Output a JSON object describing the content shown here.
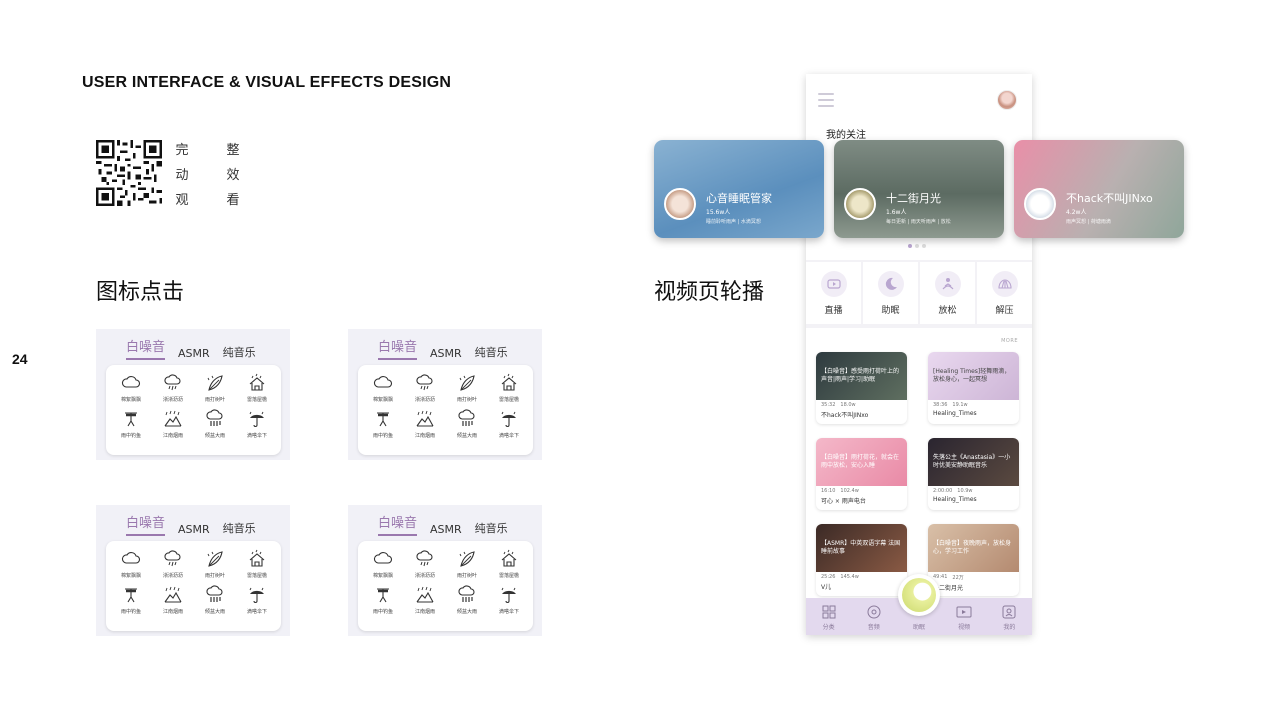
{
  "header": {
    "title": "USER INTERFACE & VISUAL EFFECTS DESIGN"
  },
  "page_number": "24",
  "qr_caption": {
    "col1": [
      "完",
      "动",
      "观"
    ],
    "col2": [
      "整",
      "效",
      "看"
    ]
  },
  "sections": {
    "icon_click": "图标点击",
    "carousel": "视频页轮播"
  },
  "tabs": [
    "白噪音",
    "ASMR",
    "纯音乐"
  ],
  "sound_icons": [
    {
      "label": "棉絮飘飘",
      "icon": "cloud-icon"
    },
    {
      "label": "淅淅沥沥",
      "icon": "cloud-rain-icon"
    },
    {
      "label": "雨打树叶",
      "icon": "leaf-rain-icon"
    },
    {
      "label": "雷落屋檐",
      "icon": "house-rain-icon"
    },
    {
      "label": "雨中钓鱼",
      "icon": "fishing-icon"
    },
    {
      "label": "江南烟雨",
      "icon": "mountain-rain-icon"
    },
    {
      "label": "倾盆大雨",
      "icon": "heavy-rain-icon"
    },
    {
      "label": "滴嗒伞下",
      "icon": "umbrella-icon"
    }
  ],
  "phone": {
    "follow_label": "我的关注",
    "carousel": [
      {
        "title": "心音睡眠管家",
        "count": "15.6w人",
        "desc": "睡前聆听雨声 | 水滴冥想"
      },
      {
        "title": "十二街月光",
        "count": "1.6w人",
        "desc": "每日更新 | 雨天听雨声 | 放松"
      },
      {
        "title": "不hack不叫JINxo",
        "count": "4.2w人",
        "desc": "雨声冥想 | 荷塘雨滴"
      }
    ],
    "categories": [
      {
        "label": "直播",
        "icon": "live-icon"
      },
      {
        "label": "助眠",
        "icon": "moon-icon"
      },
      {
        "label": "放松",
        "icon": "meditation-icon"
      },
      {
        "label": "解压",
        "icon": "shell-icon"
      }
    ],
    "more": "MORE",
    "videos": [
      {
        "title": "【白噪音】感受雨打荷叶上的声音|雨声|学习|助眠",
        "time": "35:32",
        "views": "18.0w",
        "author": "不hack不叫JINxo"
      },
      {
        "title": "[Healing Times]轻舞雨滴，放松身心，一起冥想",
        "time": "38:36",
        "views": "19.1w",
        "author": "Healing_Times"
      },
      {
        "title": "【白噪音】雨打荷花，就会在雨中放松，安心入睡",
        "time": "16:10",
        "views": "102.4w",
        "author": "可心 × 雨声电台"
      },
      {
        "title": "失落公主《Anastasia》一小时优美安静助眠音乐",
        "time": "2:00:00",
        "views": "10.9w",
        "author": "Healing_Times"
      },
      {
        "title": "【ASMR】中英双语字幕 法国睡前故事",
        "time": "25:26",
        "views": "145.4w",
        "author": "V儿"
      },
      {
        "title": "【白噪音】夜晚雨声，放松身心，学习工作",
        "time": "49:41",
        "views": "22万",
        "author": "十二街月光"
      }
    ],
    "nav": [
      {
        "label": "分类",
        "icon": "grid-icon"
      },
      {
        "label": "音频",
        "icon": "disc-icon"
      },
      {
        "label": "助眠",
        "icon": "play-icon"
      },
      {
        "label": "视频",
        "icon": "video-icon"
      },
      {
        "label": "我的",
        "icon": "user-icon"
      }
    ]
  },
  "colors": {
    "accent": "#9a78ae",
    "nav_bg": "#e3d9ee",
    "panel_bg": "#f1f1f7"
  }
}
